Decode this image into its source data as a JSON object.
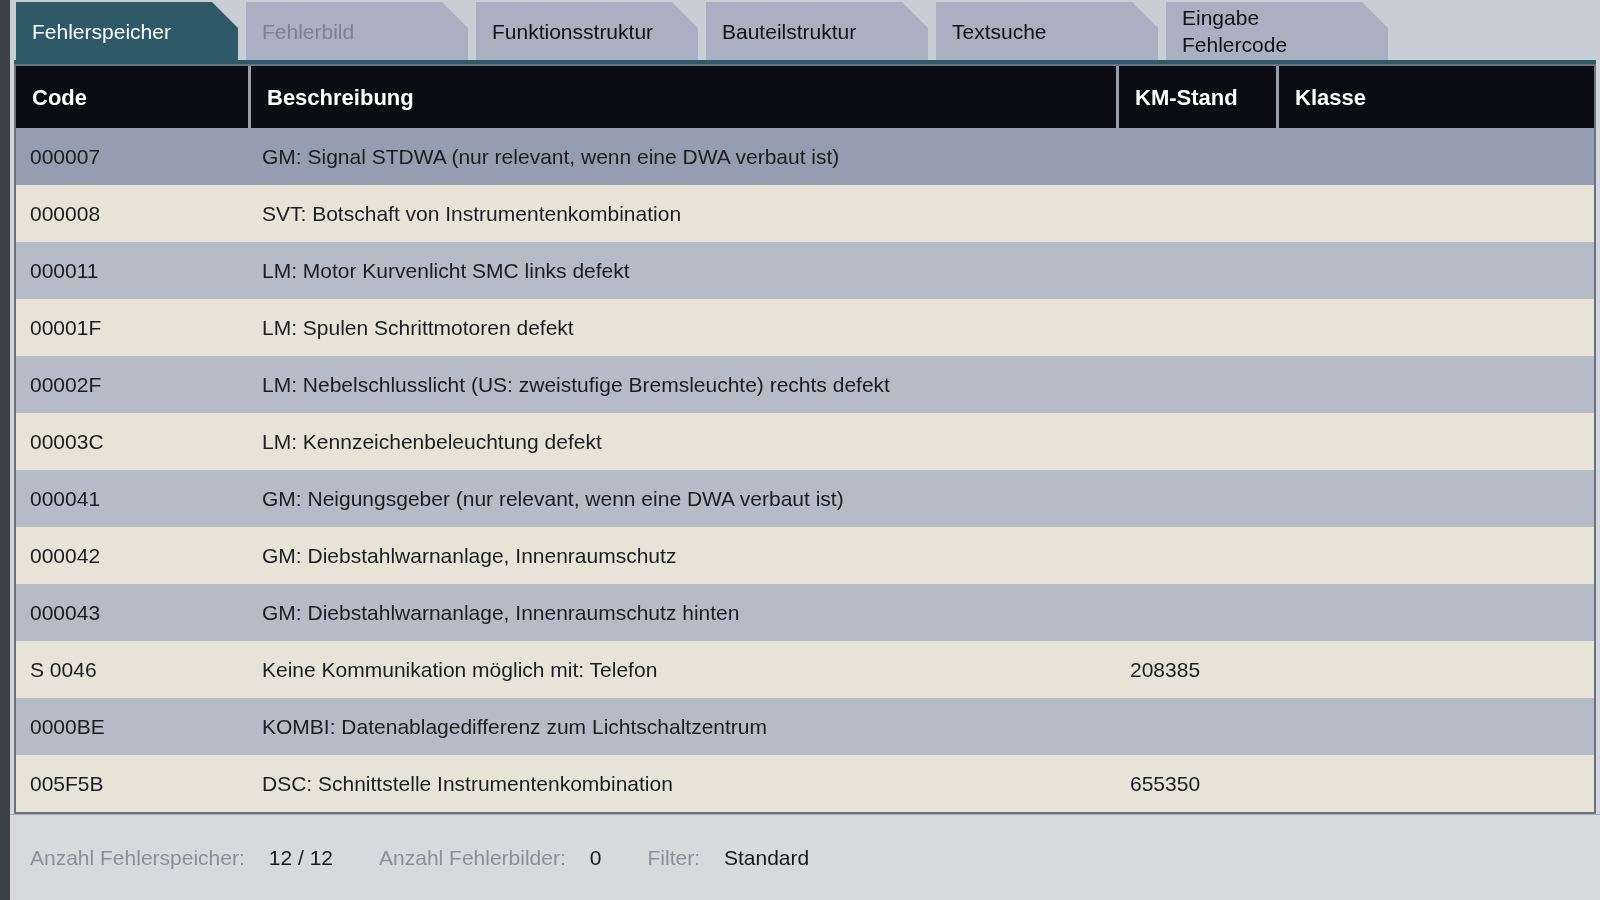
{
  "tabs": [
    {
      "label": "Fehlerspeicher",
      "selected": true,
      "disabled": false
    },
    {
      "label": "Fehlerbild",
      "selected": false,
      "disabled": true
    },
    {
      "label": "Funktionsstruktur",
      "selected": false,
      "disabled": false
    },
    {
      "label": "Bauteilstruktur",
      "selected": false,
      "disabled": false
    },
    {
      "label": "Textsuche",
      "selected": false,
      "disabled": false
    },
    {
      "label": "Eingabe Fehlercode",
      "selected": false,
      "disabled": false
    }
  ],
  "table": {
    "columns": [
      "Code",
      "Beschreibung",
      "KM-Stand",
      "Klasse"
    ],
    "rows": [
      {
        "code": "000007",
        "description": "GM: Signal STDWA (nur relevant, wenn eine DWA verbaut ist)",
        "selected": true
      },
      {
        "code": "000008",
        "description": "SVT: Botschaft von Instrumentenkombination",
        "selected": false
      },
      {
        "code": "000011",
        "description": "LM: Motor Kurvenlicht SMC links defekt",
        "selected": false
      },
      {
        "code": "00001F",
        "description": "LM: Spulen Schrittmotoren defekt",
        "selected": false
      },
      {
        "code": "00002F",
        "description": "LM: Nebelschlusslicht (US: zweistufige Bremsleuchte) rechts defekt",
        "selected": false
      },
      {
        "code": "00003C",
        "description": "LM: Kennzeichenbeleuchtung defekt",
        "selected": false
      },
      {
        "code": "000041",
        "description": "GM: Neigungsgeber (nur relevant, wenn eine DWA verbaut ist)",
        "selected": false
      },
      {
        "code": "000042",
        "description": "GM: Diebstahlwarnanlage, Innenraumschutz",
        "selected": false
      },
      {
        "code": "000043",
        "description": "GM: Diebstahlwarnanlage, Innenraumschutz hinten",
        "selected": false
      },
      {
        "code": "S 0046",
        "description": "Keine Kommunikation möglich mit: Telefon",
        "km_stand": "208385",
        "selected": false
      },
      {
        "code": "0000BE",
        "description": "KOMBI: Datenablagedifferenz zum Lichtschaltzentrum",
        "selected": false
      },
      {
        "code": "005F5B",
        "description": "DSC: Schnittstelle Instrumentenkombination",
        "km_stand": "655350",
        "selected": false
      }
    ]
  },
  "status_bar": [
    {
      "label": "Anzahl Fehlerspeicher:",
      "value": "12 / 12"
    },
    {
      "label": "Anzahl Fehlerbilder:",
      "value": "0"
    },
    {
      "label": "Filter:",
      "value": "Standard"
    }
  ]
}
